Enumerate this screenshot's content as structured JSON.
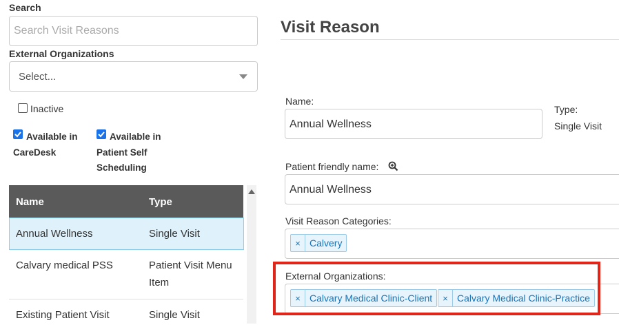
{
  "filters": {
    "search_label": "Search",
    "search_placeholder": "Search Visit Reasons",
    "ext_org_label": "External Organizations",
    "ext_org_placeholder": "Select...",
    "inactive_label": "Inactive",
    "available_caredesk_line1": "Available in",
    "available_caredesk_line2": "CareDesk",
    "available_pss_line1": "Available in",
    "available_pss_line2": "Patient Self",
    "available_pss_line3": "Scheduling"
  },
  "table": {
    "headers": [
      "Name",
      "Type"
    ],
    "rows": [
      {
        "name": "Annual Wellness",
        "type": "Single Visit"
      },
      {
        "name": "Calvary medical PSS",
        "type_line1": "Patient Visit Menu",
        "type_line2": "Item"
      },
      {
        "name": "Existing Patient Visit",
        "type": "Single Visit"
      }
    ]
  },
  "detail": {
    "title": "Visit Reason",
    "name_label": "Name:",
    "name_value": "Annual Wellness",
    "type_label": "Type:",
    "type_value": "Single Visit",
    "friendly_label": "Patient friendly name:",
    "friendly_value": "Annual Wellness",
    "categories_label": "Visit Reason Categories:",
    "categories": [
      "Calvery"
    ],
    "ext_orgs_label": "External Organizations:",
    "ext_orgs": [
      "Calvary Medical Clinic-Client",
      "Calvary Medical Clinic-Practice"
    ],
    "remove_glyph": "×"
  },
  "colors": {
    "highlight_box": "#e0261b",
    "checkbox_checked": "#1a73e8",
    "table_header": "#5a5a5a",
    "selected_row": "#dff2fb"
  }
}
